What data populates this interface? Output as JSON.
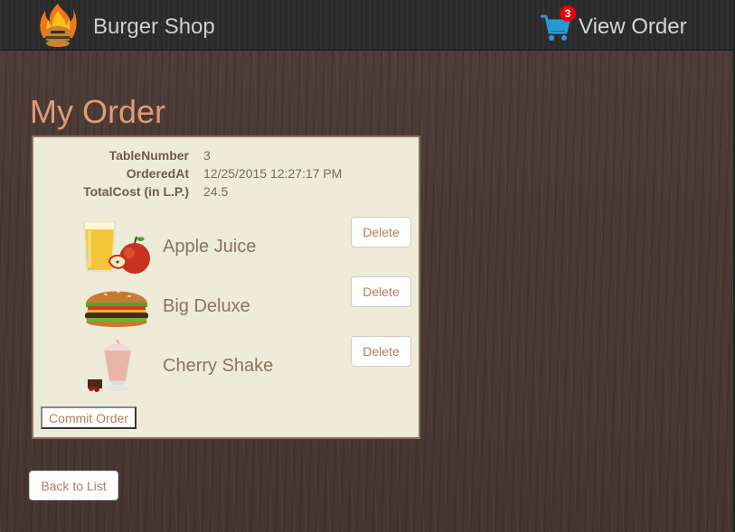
{
  "navbar": {
    "brand": "Burger Shop",
    "cart_count": "3",
    "view_order_label": "View Order",
    "logo_icon": "flaming-burger-logo",
    "cart_icon": "shopping-cart-icon",
    "accent_color": "#e60000"
  },
  "page_title": "My Order",
  "order": {
    "fields": [
      {
        "label": "TableNumber",
        "value": "3"
      },
      {
        "label": "OrderedAt",
        "value": "12/25/2015 12:27:17 PM"
      },
      {
        "label": "TotalCost  (in L.P.)",
        "value": "24.5"
      }
    ],
    "items": [
      {
        "name": "Apple Juice",
        "icon": "apple-juice-image",
        "delete_label": "Delete"
      },
      {
        "name": "Big Deluxe",
        "icon": "burger-image",
        "delete_label": "Delete"
      },
      {
        "name": "Cherry Shake",
        "icon": "milkshake-image",
        "delete_label": "Delete"
      }
    ],
    "commit_label": "Commit Order"
  },
  "back_label": "Back to List",
  "colors": {
    "title": "#e29a74",
    "panel_bg": "#eeebd9",
    "button_text": "#b57b5e"
  }
}
